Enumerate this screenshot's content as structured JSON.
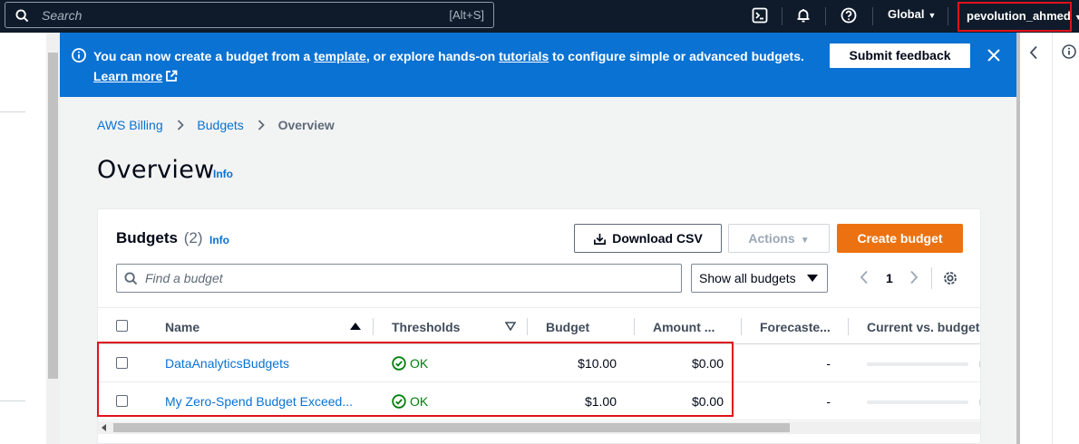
{
  "topnav": {
    "search_placeholder": "Search",
    "search_shortcut": "[Alt+S]",
    "region": "Global",
    "account": "pevolution_ahmed"
  },
  "banner": {
    "text_1": "You can now create a budget from a ",
    "link_template": "template",
    "text_2": ", or explore hands-on ",
    "link_tutorials": "tutorials",
    "text_3": " to configure simple or advanced budgets. ",
    "link_learn_more": "Learn more",
    "feedback_button": "Submit feedback"
  },
  "breadcrumb": {
    "items": [
      "AWS Billing",
      "Budgets"
    ],
    "current": "Overview"
  },
  "page": {
    "title": "Overview",
    "info": "Info"
  },
  "budgets": {
    "title": "Budgets",
    "count": "(2)",
    "info": "Info",
    "download_csv": "Download CSV",
    "actions": "Actions",
    "create_budget": "Create budget",
    "find_placeholder": "Find a budget",
    "filter_value": "Show all budgets",
    "page_number": "1",
    "columns": {
      "name": "Name",
      "thresholds": "Thresholds",
      "budget": "Budget",
      "amount": "Amount ...",
      "forecasted": "Forecaste...",
      "current_vs": "Current vs. budgete"
    },
    "rows": [
      {
        "name": "DataAnalyticsBudgets",
        "thresholds": "OK",
        "budget": "$10.00",
        "amount": "$0.00",
        "forecasted": "-",
        "progress": 0
      },
      {
        "name": "My Zero-Spend Budget Exceed...",
        "thresholds": "OK",
        "budget": "$1.00",
        "amount": "$0.00",
        "forecasted": "-",
        "progress": 0
      }
    ]
  },
  "colors": {
    "nav_bg": "#0f1b2a",
    "banner_bg": "#0972d3",
    "link": "#0972d3",
    "primary_button": "#ec7211",
    "ok_status": "#037f0c",
    "highlight": "#e0121b"
  },
  "icons": [
    "search-icon",
    "terminal-icon",
    "bell-icon",
    "help-icon",
    "info-icon",
    "external-link-icon",
    "close-icon",
    "download-icon",
    "chevron-left-icon",
    "chevron-right-icon",
    "gear-icon",
    "check-circle-icon"
  ]
}
